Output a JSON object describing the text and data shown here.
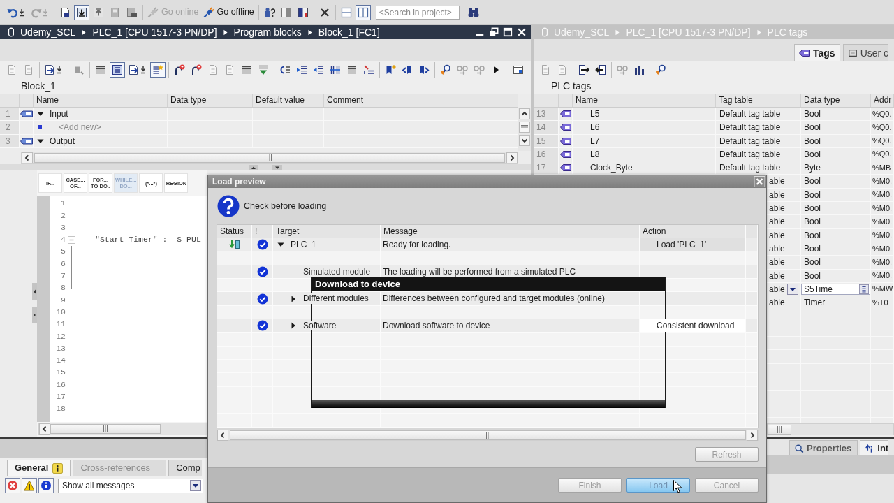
{
  "main_toolbar": {
    "icon_buttons": [
      {
        "pressed": false
      },
      {
        "pressed": false
      },
      {
        "pressed": false
      },
      {
        "pressed": true
      },
      {
        "pressed": false
      },
      {
        "pressed": false
      },
      {
        "pressed": false
      },
      {
        "pressed": false
      },
      {
        "pressed": false
      },
      {
        "pressed": false
      },
      {
        "pressed": false
      },
      {
        "pressed": false
      },
      {
        "pressed": true
      },
      {
        "pressed": false
      }
    ],
    "online_buttons": [
      {
        "label": "Go online",
        "disabled": true
      },
      {
        "label": "Go offline",
        "disabled": false
      }
    ],
    "search": {
      "placeholder": "<Search in project>"
    }
  },
  "editor": {
    "active": true,
    "breadcrumb": [
      "Udemy_SCL",
      "PLC_1 [CPU 1517-3 PN/DP]",
      "Program blocks",
      "Block_1 [FC1]"
    ],
    "toolbar": [
      {
        "pressed": false
      },
      {
        "pressed": false
      },
      {
        "pressed": false
      },
      {
        "pressed": false
      },
      {
        "pressed": false
      },
      {
        "pressed": true
      },
      {
        "pressed": false
      },
      {
        "pressed": true
      },
      {
        "pressed": false
      },
      {
        "pressed": false
      },
      {
        "pressed": false
      },
      {
        "pressed": false
      },
      {
        "pressed": false
      },
      {
        "pressed": false
      },
      {
        "pressed": false
      },
      {
        "pressed": false
      },
      {
        "pressed": false
      },
      {
        "pressed": false
      },
      {
        "pressed": false
      },
      {
        "pressed": false
      },
      {
        "pressed": false
      },
      {
        "pressed": false
      },
      {
        "pressed": false
      },
      {
        "pressed": false
      },
      {
        "pressed": false
      },
      {
        "pressed": false
      },
      {
        "pressed": false
      },
      {
        "pressed": false
      }
    ],
    "block_title": "Block_1",
    "interface": {
      "columns": [
        "Name",
        "Data type",
        "Default value",
        "Comment"
      ],
      "rows": [
        {
          "number": "1",
          "kind": "section",
          "name": "Input",
          "expanded": true
        },
        {
          "number": "2",
          "kind": "add",
          "name": "<Add new>"
        },
        {
          "number": "3",
          "kind": "section",
          "name": "Output",
          "expanded": true
        }
      ]
    },
    "instructions": [
      {
        "label": "IF...",
        "highlighted": false
      },
      {
        "label": "CASE...\nOF...",
        "highlighted": false
      },
      {
        "label": "FOR...\nTO DO..",
        "highlighted": false
      },
      {
        "label": "WHILE...\nDO...",
        "highlighted": true
      },
      {
        "label": "(*...*)",
        "highlighted": false
      },
      {
        "label": "REGION",
        "highlighted": false
      }
    ],
    "code_lines": [
      {
        "number": "1"
      },
      {
        "number": "2"
      },
      {
        "number": "3"
      },
      {
        "number": "4",
        "text": "\"Start_Timer\" := S_PUL",
        "expanded": true,
        "children": [
          {
            "number": "5"
          },
          {
            "number": "6"
          },
          {
            "number": "7"
          },
          {
            "number": "8"
          }
        ]
      },
      {
        "number": "9"
      },
      {
        "number": "10"
      },
      {
        "number": "11"
      },
      {
        "number": "12"
      },
      {
        "number": "13"
      },
      {
        "number": "14"
      },
      {
        "number": "15"
      },
      {
        "number": "16"
      },
      {
        "number": "17"
      },
      {
        "number": "18"
      }
    ]
  },
  "inspector": {
    "tabs": [
      {
        "label": "General",
        "selected": true,
        "info_marker": true,
        "disabled": false
      },
      {
        "label": "Cross-references",
        "selected": false,
        "info_marker": false,
        "disabled": true
      },
      {
        "label": "Comp",
        "selected": false,
        "info_marker": false,
        "disabled": false
      }
    ],
    "filters": [
      {
        "pressed": true
      },
      {
        "pressed": true
      },
      {
        "pressed": true
      }
    ],
    "message_filter": {
      "value": "Show all messages"
    }
  },
  "tags_panel": {
    "active": false,
    "breadcrumb": [
      "Udemy_SCL",
      "PLC_1 [CPU 1517-3 PN/DP]",
      "PLC tags"
    ],
    "tabs": [
      {
        "label": "Tags",
        "selected": true
      },
      {
        "label": "User c",
        "selected": false
      }
    ],
    "title": "PLC tags",
    "columns": [
      "Name",
      "Tag table",
      "Data type",
      "Addr"
    ],
    "rows": [
      {
        "number": "13",
        "name": "L5",
        "tag_table": "Default tag table",
        "data_type": "Bool",
        "address": "%Q0.",
        "editing": false
      },
      {
        "number": "14",
        "name": "L6",
        "tag_table": "Default tag table",
        "data_type": "Bool",
        "address": "%Q0.",
        "editing": false
      },
      {
        "number": "15",
        "name": "L7",
        "tag_table": "Default tag table",
        "data_type": "Bool",
        "address": "%Q0.",
        "editing": false
      },
      {
        "number": "16",
        "name": "L8",
        "tag_table": "Default tag table",
        "data_type": "Bool",
        "address": "%Q0.",
        "editing": false
      },
      {
        "number": "17",
        "name": "Clock_Byte",
        "tag_table": "Default tag table",
        "data_type": "Byte",
        "address": "%MB",
        "editing": false
      },
      {
        "tag_table": "able",
        "data_type": "Bool",
        "address": "%M0.",
        "editing": false
      },
      {
        "tag_table": "able",
        "data_type": "Bool",
        "address": "%M0.",
        "editing": false
      },
      {
        "tag_table": "able",
        "data_type": "Bool",
        "address": "%M0.",
        "editing": false
      },
      {
        "tag_table": "able",
        "data_type": "Bool",
        "address": "%M0.",
        "editing": false
      },
      {
        "tag_table": "able",
        "data_type": "Bool",
        "address": "%M0.",
        "editing": false
      },
      {
        "tag_table": "able",
        "data_type": "Bool",
        "address": "%M0.",
        "editing": false
      },
      {
        "tag_table": "able",
        "data_type": "Bool",
        "address": "%M0.",
        "editing": false
      },
      {
        "tag_table": "able",
        "data_type": "Bool",
        "address": "%M0.",
        "editing": false
      },
      {
        "tag_table": "able",
        "data_type": "S5Time",
        "address": "%MW",
        "editing": true
      },
      {
        "tag_table": "able",
        "data_type": "Timer",
        "address": "%T0",
        "editing": false
      }
    ],
    "inspector_tabs": [
      {
        "label": "Properties",
        "selected": false
      },
      {
        "label": "Int",
        "selected": true
      }
    ]
  },
  "dialog": {
    "title": "Load preview",
    "header": "Check before loading",
    "columns": [
      "Status",
      "!",
      "Target",
      "Message",
      "Action"
    ],
    "rows": [
      {
        "download_ready": true,
        "ok": true,
        "target": "PLC_1",
        "message": "Ready for loading.",
        "action": "Load 'PLC_1'",
        "expanded": true,
        "children": [
          {
            "ok": true,
            "target": "Simulated module",
            "message": "The loading will be performed from a simulated PLC"
          },
          {
            "ok": true,
            "target": "Different modules",
            "message": "Differences between configured and target modules (online)",
            "expanded": false
          },
          {
            "ok": true,
            "target": "Software",
            "message": "Download software to device",
            "action": "Consistent download",
            "expanded": false
          }
        ]
      }
    ],
    "refresh_button": {
      "label": "Refresh",
      "disabled": true
    },
    "buttons": [
      {
        "label": "Finish",
        "disabled": true,
        "hovered": false
      },
      {
        "label": "Load",
        "disabled": true,
        "hovered": true
      },
      {
        "label": "Cancel",
        "disabled": true,
        "hovered": false
      }
    ],
    "progress_window": {
      "title": "Download to device"
    }
  }
}
